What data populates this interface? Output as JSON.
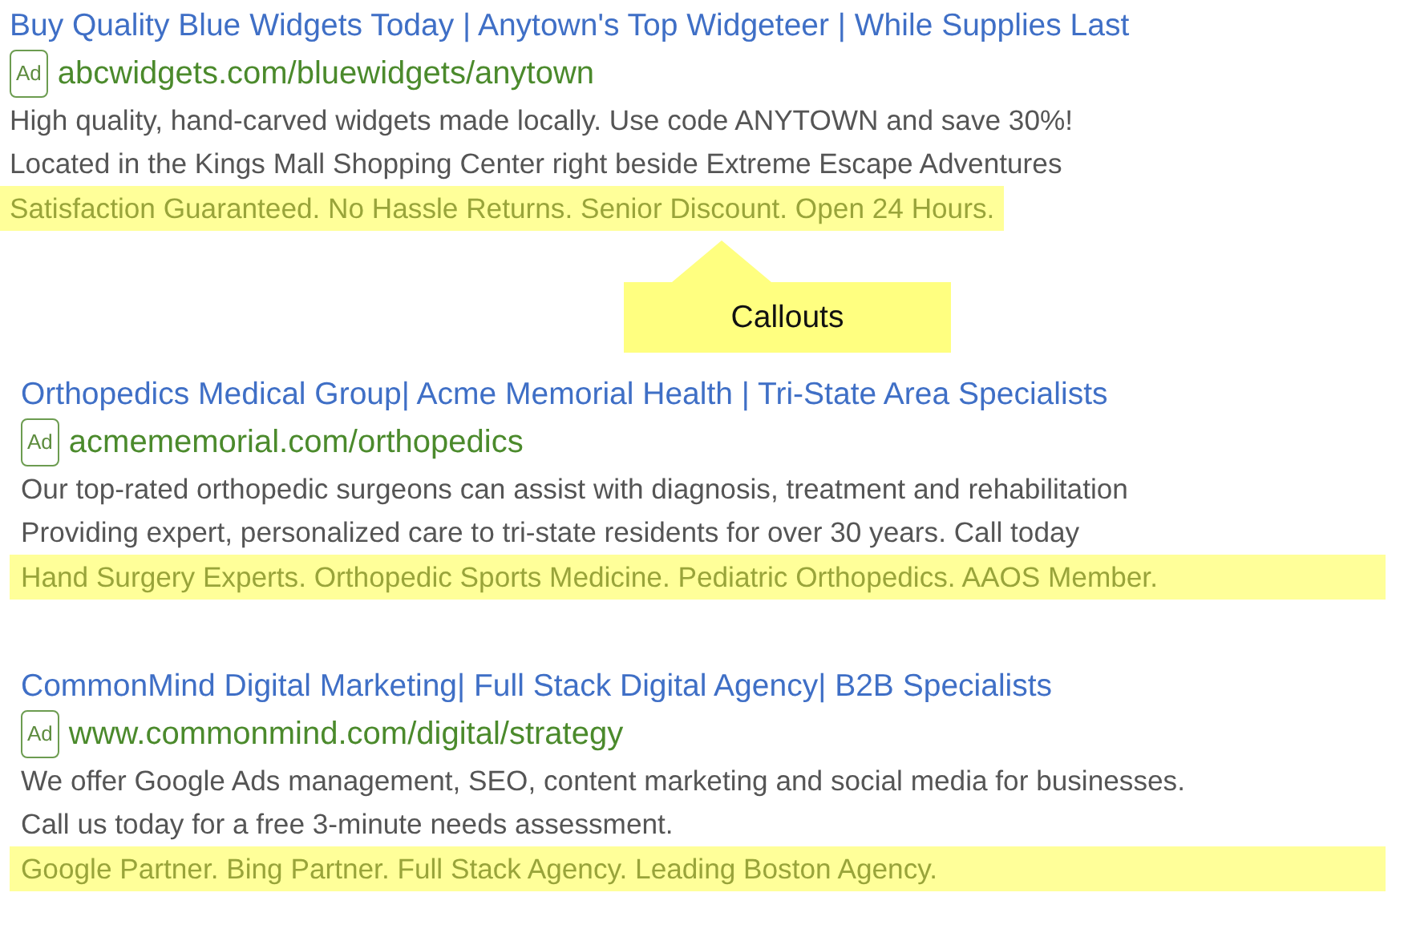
{
  "ads": [
    {
      "title": "Buy Quality Blue Widgets Today | Anytown's Top Widgeteer | While Supplies Last",
      "badge": "Ad",
      "url": "abcwidgets.com/bluewidgets/anytown",
      "description": [
        "High quality, hand-carved widgets made locally. Use code ANYTOWN and save 30%!",
        "Located in the Kings Mall Shopping Center right beside Extreme Escape Adventures"
      ],
      "callouts": "Satisfaction Guaranteed. No Hassle Returns. Senior Discount. Open 24 Hours."
    },
    {
      "title": "Orthopedics Medical Group| Acme Memorial Health | Tri-State Area Specialists",
      "badge": "Ad",
      "url": "acmememorial.com/orthopedics",
      "description": [
        "Our top-rated orthopedic surgeons can assist with diagnosis, treatment and rehabilitation",
        "Providing expert, personalized care to tri-state residents for over 30 years. Call today"
      ],
      "callouts": "Hand Surgery Experts. Orthopedic Sports Medicine. Pediatric Orthopedics. AAOS Member."
    },
    {
      "title": "CommonMind Digital Marketing| Full Stack Digital Agency| B2B Specialists",
      "badge": "Ad",
      "url": "www.commonmind.com/digital/strategy",
      "description": [
        "We offer Google Ads management, SEO, content marketing and social media for businesses.",
        "Call us today for a free 3-minute needs assessment."
      ],
      "callouts": "Google Partner. Bing Partner. Full Stack Agency. Leading Boston Agency."
    }
  ],
  "annotation": {
    "label": "Callouts"
  }
}
